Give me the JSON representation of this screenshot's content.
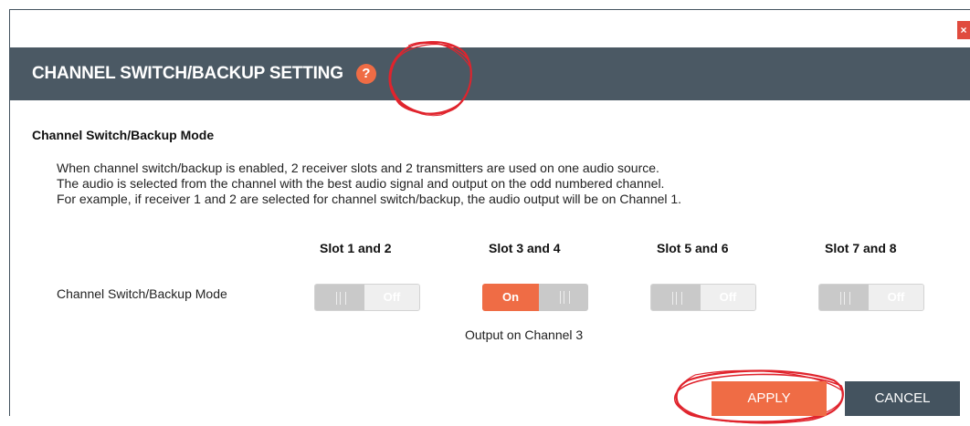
{
  "dialog": {
    "title": "CHANNEL SWITCH/BACKUP SETTING",
    "help_icon": "question-circle-icon",
    "close_icon": "close-icon",
    "close_symbol": "×",
    "help_symbol": "?"
  },
  "section": {
    "title": "Channel Switch/Backup Mode",
    "description": [
      "When channel switch/backup is enabled, 2 receiver slots and 2 transmitters are used on one audio source.",
      "The audio is selected from the channel with the best audio signal and output on the odd numbered channel.",
      "For example, if receiver 1 and 2 are selected for channel switch/backup, the audio output will be on Channel 1."
    ]
  },
  "slots": {
    "headers": [
      "Slot 1 and 2",
      "Slot 3 and 4",
      "Slot 5 and 6",
      "Slot 7 and 8"
    ],
    "row_label": "Channel Switch/Backup Mode",
    "toggles": [
      {
        "state": "Off",
        "on": false
      },
      {
        "state": "On",
        "on": true
      },
      {
        "state": "Off",
        "on": false
      },
      {
        "state": "Off",
        "on": false
      }
    ],
    "output_text": "Output on Channel 3"
  },
  "buttons": {
    "apply": "APPLY",
    "cancel": "CANCEL"
  },
  "colors": {
    "accent": "#ef6c45",
    "header_bg": "#4b5964",
    "cancel_bg": "#44535f",
    "annotation": "#e0242d"
  }
}
